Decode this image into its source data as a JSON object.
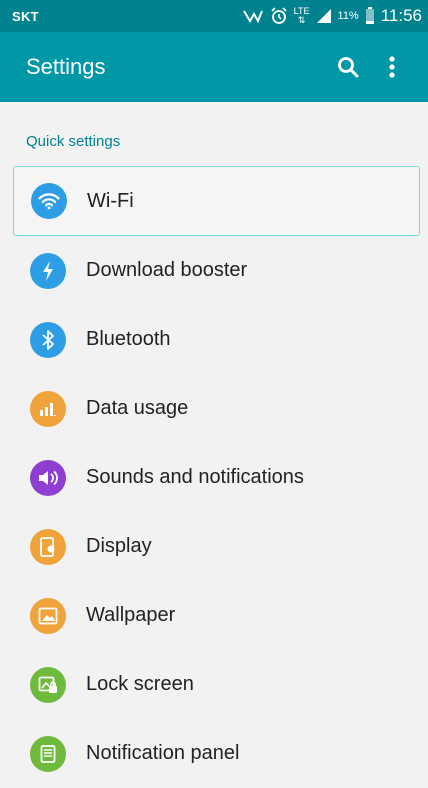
{
  "status_bar": {
    "carrier": "SKT",
    "network": "LTE",
    "battery_percent": "11%",
    "time": "11:56"
  },
  "app_bar": {
    "title": "Settings",
    "search_icon": "search-icon",
    "more_icon": "more-vert-icon"
  },
  "section": {
    "title": "Quick settings"
  },
  "items": [
    {
      "label": "Wi-Fi",
      "icon": "wifi-icon",
      "color": "#2d9ee6",
      "selected": true
    },
    {
      "label": "Download booster",
      "icon": "lightning-icon",
      "color": "#2d9ee6"
    },
    {
      "label": "Bluetooth",
      "icon": "bluetooth-icon",
      "color": "#2d9ee6"
    },
    {
      "label": "Data usage",
      "icon": "bar-chart-icon",
      "color": "#f0a33a"
    },
    {
      "label": "Sounds and notifications",
      "icon": "speaker-icon",
      "color": "#8e3fd1"
    },
    {
      "label": "Display",
      "icon": "display-icon",
      "color": "#f0a33a"
    },
    {
      "label": "Wallpaper",
      "icon": "image-icon",
      "color": "#f0a33a"
    },
    {
      "label": "Lock screen",
      "icon": "lock-screen-icon",
      "color": "#6dba3c"
    },
    {
      "label": "Notification panel",
      "icon": "notification-panel-icon",
      "color": "#6dba3c"
    }
  ],
  "colors": {
    "status_bar": "#00838f",
    "app_bar": "#0097a7",
    "section_header": "#00838f",
    "background": "#f2f2f2"
  }
}
